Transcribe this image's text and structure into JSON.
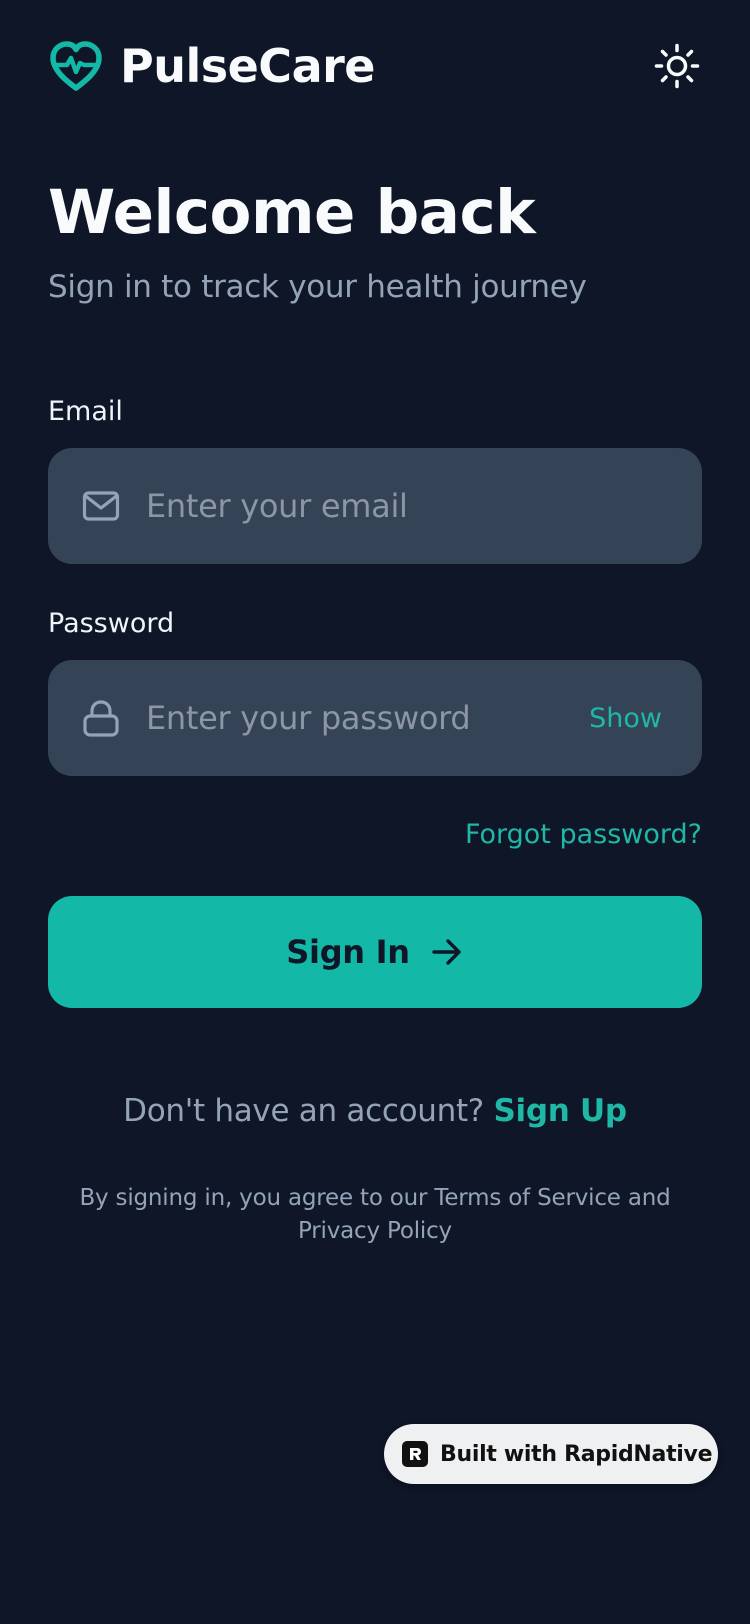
{
  "app": {
    "brand_name": "PulseCare",
    "accent_color": "#14b8a6",
    "background_color": "#0e1628",
    "brand_icon": "heart-pulse-icon",
    "theme_icon": "sun-icon"
  },
  "header": {
    "title": "Welcome back",
    "subtitle": "Sign in to track your health journey"
  },
  "form": {
    "email": {
      "label": "Email",
      "placeholder": "Enter your email",
      "value": "",
      "icon": "mail-icon"
    },
    "password": {
      "label": "Password",
      "placeholder": "Enter your password",
      "value": "",
      "icon": "lock-icon",
      "toggle_label": "Show"
    },
    "forgot_label": "Forgot password?",
    "submit_label": "Sign In",
    "submit_icon": "arrow-right-icon"
  },
  "signup": {
    "prompt": "Don't have an account?",
    "link_label": "Sign Up"
  },
  "legal": {
    "text": "By signing in, you agree to our Terms of Service and Privacy Policy"
  },
  "badge": {
    "label": "Built with RapidNative",
    "icon": "rapidnative-logo-icon"
  }
}
